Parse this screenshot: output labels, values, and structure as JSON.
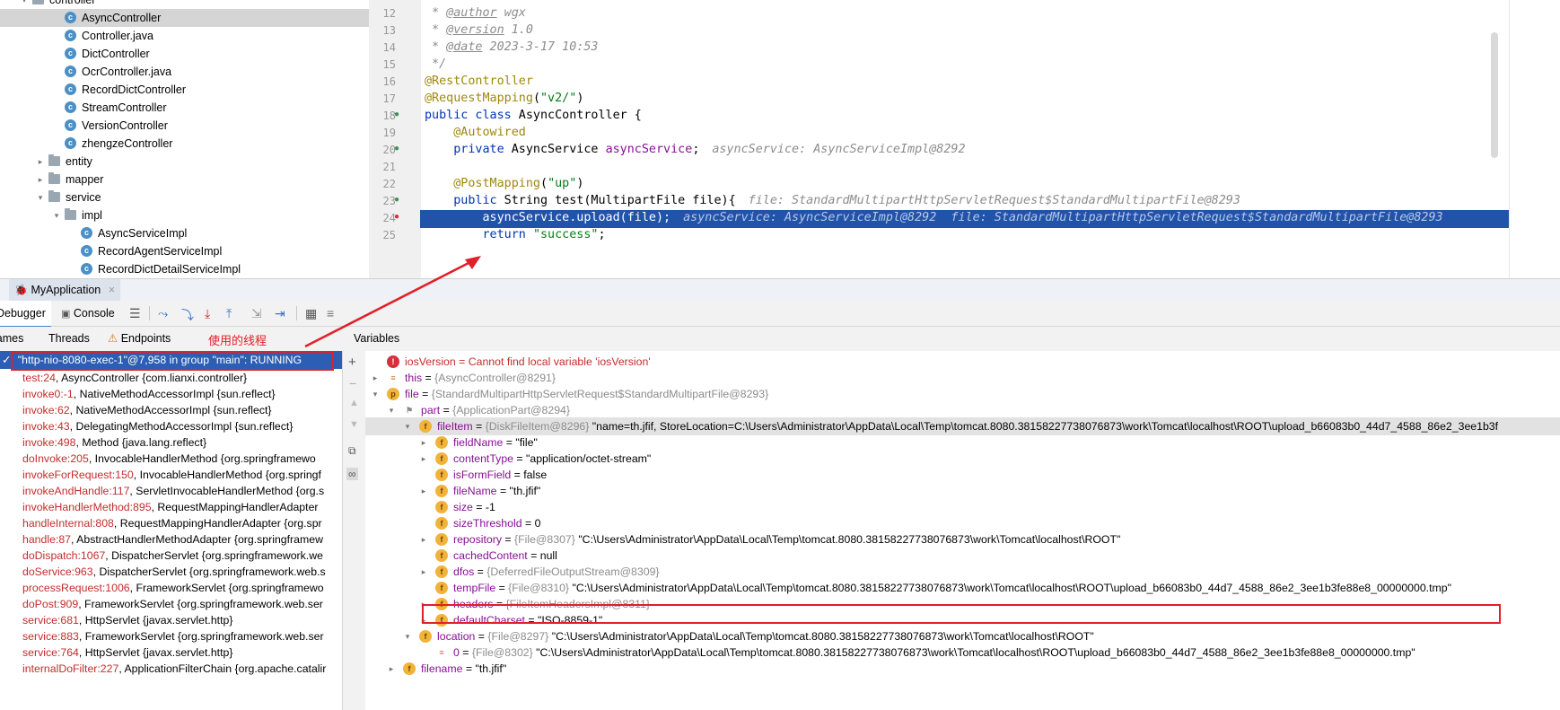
{
  "tree": {
    "items": [
      {
        "label": "controller",
        "kind": "folder",
        "indent": 1,
        "arrow": "▾"
      },
      {
        "label": "AsyncController",
        "kind": "class",
        "indent": 3,
        "selected": true
      },
      {
        "label": "Controller.java",
        "kind": "class",
        "indent": 3
      },
      {
        "label": "DictController",
        "kind": "class",
        "indent": 3
      },
      {
        "label": "OcrController.java",
        "kind": "class",
        "indent": 3
      },
      {
        "label": "RecordDictController",
        "kind": "class",
        "indent": 3
      },
      {
        "label": "StreamController",
        "kind": "class",
        "indent": 3
      },
      {
        "label": "VersionController",
        "kind": "class",
        "indent": 3
      },
      {
        "label": "zhengzeController",
        "kind": "class",
        "indent": 3
      },
      {
        "label": "entity",
        "kind": "folder",
        "indent": 2,
        "arrow": "▸"
      },
      {
        "label": "mapper",
        "kind": "folder",
        "indent": 2,
        "arrow": "▸"
      },
      {
        "label": "service",
        "kind": "folder",
        "indent": 2,
        "arrow": "▾"
      },
      {
        "label": "impl",
        "kind": "folder",
        "indent": 3,
        "arrow": "▾"
      },
      {
        "label": "AsyncServiceImpl",
        "kind": "class",
        "indent": 4
      },
      {
        "label": "RecordAgentServiceImpl",
        "kind": "class",
        "indent": 4
      },
      {
        "label": "RecordDictDetailServiceImpl",
        "kind": "class",
        "indent": 4
      }
    ]
  },
  "editor": {
    "lines": [
      {
        "n": "12",
        "html": "<span class=\"cm\"> * </span><span class=\"cmt\">@author</span><span class=\"cm\"> wgx</span>"
      },
      {
        "n": "13",
        "html": "<span class=\"cm\"> * </span><span class=\"cmt\">@version</span><span class=\"cm\"> 1.0</span>"
      },
      {
        "n": "14",
        "html": "<span class=\"cm\"> * </span><span class=\"cmt\">@date</span><span class=\"cm\"> 2023-3-17 10:53</span>"
      },
      {
        "n": "15",
        "html": "<span class=\"cm\"> */</span>"
      },
      {
        "n": "16",
        "html": "<span class=\"an\">@RestController</span>"
      },
      {
        "n": "17",
        "html": "<span class=\"an\">@RequestMapping</span>(<span class=\"st\">\"v2/\"</span>)"
      },
      {
        "n": "18",
        "html": "<span class=\"kw\">public class</span> AsyncController {"
      },
      {
        "n": "19",
        "html": "    <span class=\"an\">@Autowired</span>"
      },
      {
        "n": "20",
        "html": "    <span class=\"kw\">private</span> AsyncService <span class=\"fld\">asyncService</span>;<span class=\"hint\">asyncService: AsyncServiceImpl@8292</span>"
      },
      {
        "n": "21",
        "html": ""
      },
      {
        "n": "22",
        "html": "    <span class=\"an\">@PostMapping</span>(<span class=\"st\">\"up\"</span>)"
      },
      {
        "n": "23",
        "html": "    <span class=\"kw\">public</span> String test(MultipartFile file){<span class=\"hint\">file: StandardMultipartHttpServletRequest$StandardMultipartFile@8293</span>"
      },
      {
        "n": "24",
        "html": "        asyncService.upload(file);<span class=\"hint\">asyncService: AsyncServiceImpl@8292  file: StandardMultipartHttpServletRequest$StandardMultipartFile@8293</span>",
        "exec": true
      },
      {
        "n": "25",
        "html": "        <span class=\"kw\">return</span> <span class=\"st\">\"success\"</span>;"
      }
    ]
  },
  "run": {
    "tab_label": "MyApplication"
  },
  "toolbar": {
    "debugger": "Debugger",
    "console": "Console"
  },
  "panes": {
    "frames_tab": "Frames",
    "threads_tab": "Threads",
    "endpoints_tab": "Endpoints",
    "variables_title": "Variables",
    "annotation": "使用的线程"
  },
  "thread": {
    "label": "\"http-nio-8080-exec-1\"@7,958 in group \"main\": RUNNING"
  },
  "frames": [
    {
      "m": "test:24",
      "rest": ", AsyncController {com.lianxi.controller}"
    },
    {
      "m": "invoke0:-1",
      "rest": ", NativeMethodAccessorImpl {sun.reflect}"
    },
    {
      "m": "invoke:62",
      "rest": ", NativeMethodAccessorImpl {sun.reflect}"
    },
    {
      "m": "invoke:43",
      "rest": ", DelegatingMethodAccessorImpl {sun.reflect}"
    },
    {
      "m": "invoke:498",
      "rest": ", Method {java.lang.reflect}"
    },
    {
      "m": "doInvoke:205",
      "rest": ", InvocableHandlerMethod {org.springframewo"
    },
    {
      "m": "invokeForRequest:150",
      "rest": ", InvocableHandlerMethod {org.springf"
    },
    {
      "m": "invokeAndHandle:117",
      "rest": ", ServletInvocableHandlerMethod {org.s"
    },
    {
      "m": "invokeHandlerMethod:895",
      "rest": ", RequestMappingHandlerAdapter"
    },
    {
      "m": "handleInternal:808",
      "rest": ", RequestMappingHandlerAdapter {org.spr"
    },
    {
      "m": "handle:87",
      "rest": ", AbstractHandlerMethodAdapter {org.springframew"
    },
    {
      "m": "doDispatch:1067",
      "rest": ", DispatcherServlet {org.springframework.we"
    },
    {
      "m": "doService:963",
      "rest": ", DispatcherServlet {org.springframework.web.s"
    },
    {
      "m": "processRequest:1006",
      "rest": ", FrameworkServlet {org.springframewo"
    },
    {
      "m": "doPost:909",
      "rest": ", FrameworkServlet {org.springframework.web.ser"
    },
    {
      "m": "service:681",
      "rest": ", HttpServlet {javax.servlet.http}"
    },
    {
      "m": "service:883",
      "rest": ", FrameworkServlet {org.springframework.web.ser"
    },
    {
      "m": "service:764",
      "rest": ", HttpServlet {javax.servlet.http}"
    },
    {
      "m": "internalDoFilter:227",
      "rest": ", ApplicationFilterChain {org.apache.catalir"
    }
  ],
  "variables": [
    {
      "indent": 0,
      "arrow": "",
      "badge": "err",
      "name": "iosVersion",
      "text": "iosVersion = Cannot find local variable 'iosVersion'",
      "err": true
    },
    {
      "indent": 0,
      "arrow": "▸",
      "badge": "list",
      "name": "this",
      "ref": "{AsyncController@8291}",
      "val": ""
    },
    {
      "indent": 0,
      "arrow": "▾",
      "badge": "p",
      "name": "file",
      "ref": "{StandardMultipartHttpServletRequest$StandardMultipartFile@8293}",
      "val": ""
    },
    {
      "indent": 1,
      "arrow": "▾",
      "badge": "fl",
      "name": "part",
      "ref": "{ApplicationPart@8294}",
      "val": ""
    },
    {
      "indent": 2,
      "arrow": "▾",
      "badge": "f",
      "name": "fileItem",
      "ref": "{DiskFileItem@8296}",
      "val": "\"name=th.jfif, StoreLocation=C:\\Users\\Administrator\\AppData\\Local\\Temp\\tomcat.8080.38158227738076873\\work\\Tomcat\\localhost\\ROOT\\upload_b66083b0_44d7_4588_86e2_3ee1b3f",
      "hl": true
    },
    {
      "indent": 3,
      "arrow": "▸",
      "badge": "f",
      "name": "fieldName",
      "ref": "",
      "val": "\"file\""
    },
    {
      "indent": 3,
      "arrow": "▸",
      "badge": "f",
      "name": "contentType",
      "ref": "",
      "val": "\"application/octet-stream\""
    },
    {
      "indent": 3,
      "arrow": "",
      "badge": "f",
      "name": "isFormField",
      "ref": "",
      "val": "false"
    },
    {
      "indent": 3,
      "arrow": "▸",
      "badge": "f",
      "name": "fileName",
      "ref": "",
      "val": "\"th.jfif\""
    },
    {
      "indent": 3,
      "arrow": "",
      "badge": "f",
      "name": "size",
      "ref": "",
      "val": "-1"
    },
    {
      "indent": 3,
      "arrow": "",
      "badge": "f",
      "name": "sizeThreshold",
      "ref": "",
      "val": "0"
    },
    {
      "indent": 3,
      "arrow": "▸",
      "badge": "f",
      "name": "repository",
      "ref": "{File@8307}",
      "val": "\"C:\\Users\\Administrator\\AppData\\Local\\Temp\\tomcat.8080.38158227738076873\\work\\Tomcat\\localhost\\ROOT\""
    },
    {
      "indent": 3,
      "arrow": "",
      "badge": "f",
      "name": "cachedContent",
      "ref": "",
      "val": "null"
    },
    {
      "indent": 3,
      "arrow": "▸",
      "badge": "f",
      "name": "dfos",
      "ref": "{DeferredFileOutputStream@8309}",
      "val": ""
    },
    {
      "indent": 3,
      "arrow": "",
      "badge": "f",
      "name": "tempFile",
      "ref": "{File@8310}",
      "val": "\"C:\\Users\\Administrator\\AppData\\Local\\Temp\\tomcat.8080.38158227738076873\\work\\Tomcat\\localhost\\ROOT\\upload_b66083b0_44d7_4588_86e2_3ee1b3fe88e8_00000000.tmp\"",
      "boxed": true
    },
    {
      "indent": 3,
      "arrow": "▸",
      "badge": "f",
      "name": "headers",
      "ref": "{FileItemHeadersImpl@8311}",
      "val": ""
    },
    {
      "indent": 3,
      "arrow": "▸",
      "badge": "f",
      "name": "defaultCharset",
      "ref": "",
      "val": "\"ISO-8859-1\""
    },
    {
      "indent": 2,
      "arrow": "▾",
      "badge": "f",
      "name": "location",
      "ref": "{File@8297}",
      "val": "\"C:\\Users\\Administrator\\AppData\\Local\\Temp\\tomcat.8080.38158227738076873\\work\\Tomcat\\localhost\\ROOT\""
    },
    {
      "indent": 3,
      "arrow": "",
      "badge": "list",
      "name": "0",
      "ref": "{File@8302}",
      "val": "\"C:\\Users\\Administrator\\AppData\\Local\\Temp\\tomcat.8080.38158227738076873\\work\\Tomcat\\localhost\\ROOT\\upload_b66083b0_44d7_4588_86e2_3ee1b3fe88e8_00000000.tmp\""
    },
    {
      "indent": 1,
      "arrow": "▸",
      "badge": "f",
      "name": "filename",
      "ref": "",
      "val": "\"th.jfif\""
    }
  ],
  "colors": {
    "accent": "#2154a8",
    "annotation": "#e0202a",
    "frame_method": "#c22d2d"
  }
}
